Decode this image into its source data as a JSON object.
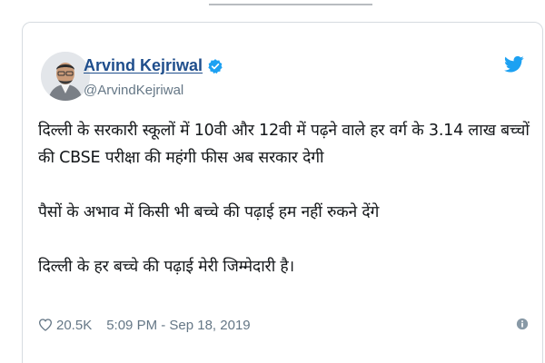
{
  "tweet": {
    "author_name": "Arvind Kejriwal",
    "handle": "@ArvindKejriwal",
    "paragraphs": [
      "दिल्ली के सरकारी स्कूलों में 10वी और 12वी में पढ़ने वाले हर वर्ग के 3.14 लाख बच्चों की CBSE परीक्षा की महंगी फीस अब सरकार देगी",
      "पैसों के अभाव में किसी भी बच्चे की पढ़ाई हम नहीं रुकने देंगे",
      "दिल्ली के हर बच्चे की पढ़ाई मेरी जिम्मेदारी है।"
    ],
    "likes": "20.5K",
    "timestamp": "5:09 PM - Sep 18, 2019"
  },
  "icons": {
    "verified": "verified-badge-icon",
    "twitter": "twitter-bird-icon",
    "like": "heart-icon",
    "info": "info-icon"
  },
  "colors": {
    "name": "#1f4e8c",
    "twitter_blue": "#1da1f2",
    "muted": "#657786",
    "border": "#d6dbe0"
  }
}
